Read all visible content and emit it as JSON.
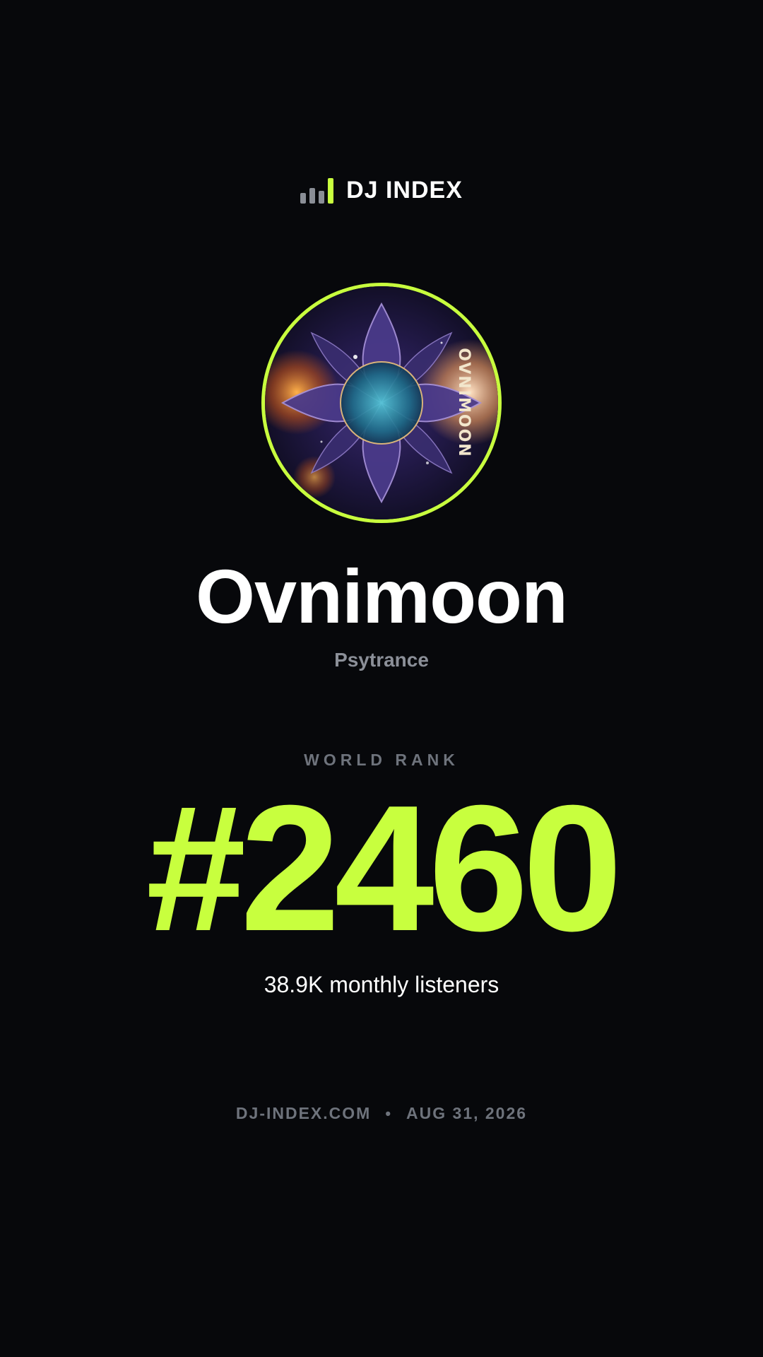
{
  "brand": {
    "name": "DJ INDEX",
    "icon": "bar-chart-icon",
    "bar_colors": [
      "#8a8e96",
      "#8a8e96",
      "#8a8e96",
      "#c8ff3e"
    ]
  },
  "artist": {
    "name": "Ovnimoon",
    "genre": "Psytrance",
    "avatar_text": "OVNIMOON",
    "ring_color": "#c8ff3e"
  },
  "rank": {
    "label": "WORLD RANK",
    "value": "#2460",
    "color": "#c8ff3e"
  },
  "stats": {
    "listeners": "38.9K monthly listeners"
  },
  "footer": {
    "site": "DJ-INDEX.COM",
    "separator": "•",
    "date": "AUG 31, 2026"
  },
  "colors": {
    "background": "#07080b",
    "muted": "#6e737c",
    "accent": "#c8ff3e"
  }
}
